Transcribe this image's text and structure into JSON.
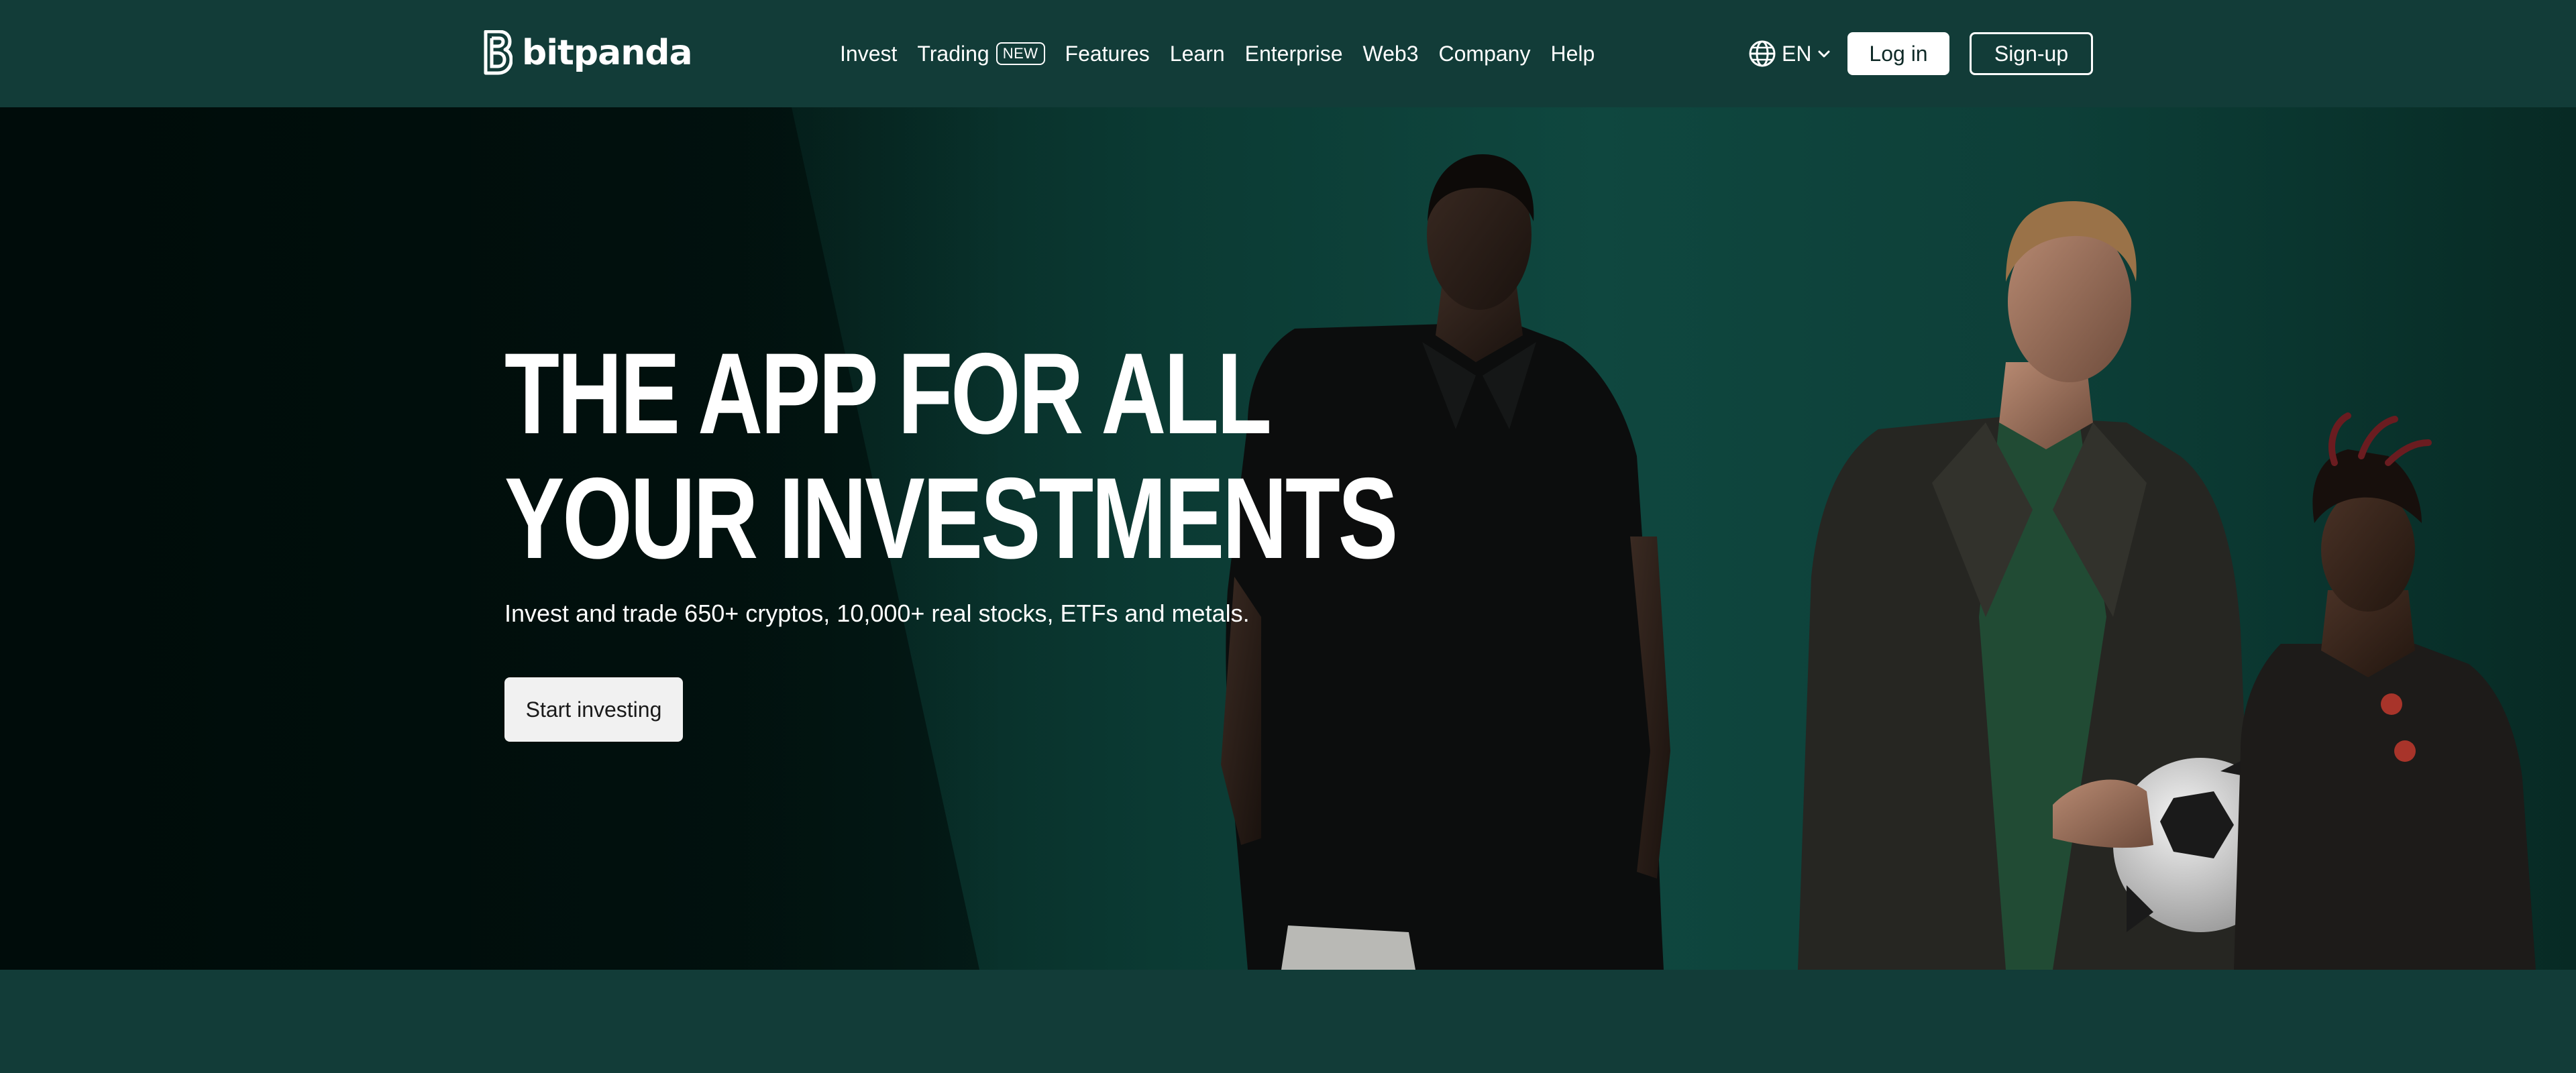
{
  "nav": {
    "logo_text": "bitpanda",
    "items": [
      {
        "label": "Invest"
      },
      {
        "label": "Trading",
        "badge": "NEW"
      },
      {
        "label": "Features"
      },
      {
        "label": "Learn"
      },
      {
        "label": "Enterprise"
      },
      {
        "label": "Web3"
      },
      {
        "label": "Company"
      },
      {
        "label": "Help"
      }
    ],
    "language": "EN",
    "login_label": "Log in",
    "signup_label": "Sign-up"
  },
  "hero": {
    "headline_line1": "THE APP FOR ALL",
    "headline_line2": "YOUR INVESTMENTS",
    "subtitle": "Invest and trade 650+ cryptos, 10,000+ real stocks, ETFs and metals.",
    "cta_label": "Start investing"
  },
  "colors": {
    "nav_background": "#123c38",
    "hero_dark": "#031a16",
    "hero_green": "#0f473f",
    "cta_background": "#f1f1f1"
  }
}
